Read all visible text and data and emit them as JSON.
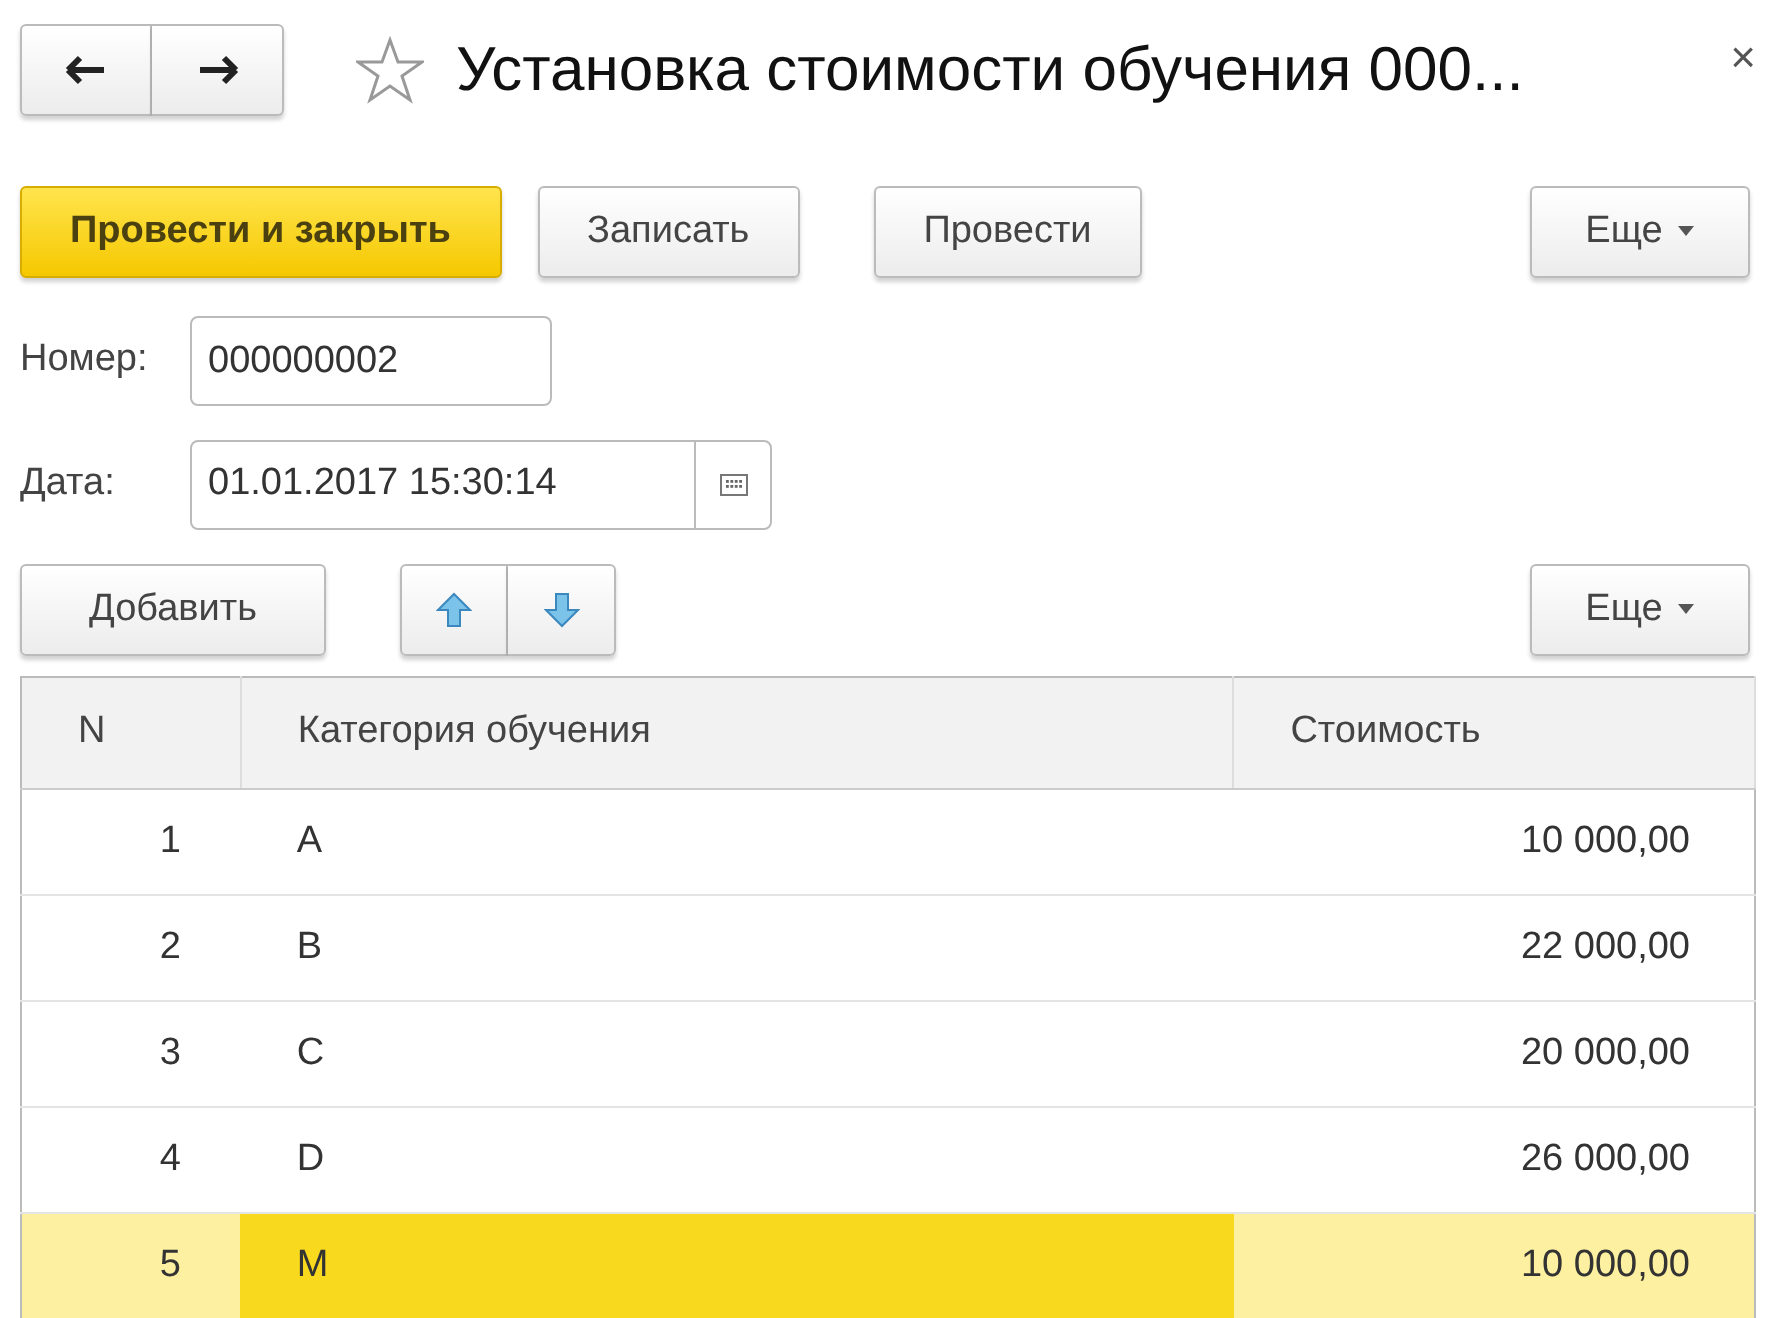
{
  "window": {
    "title": "Установка стоимости обучения 000...",
    "favorite": false,
    "close": "×"
  },
  "toolbar": {
    "buttons": [
      {
        "label": "Провести и закрыть",
        "kind": "primary"
      },
      {
        "label": "Записать",
        "kind": "default"
      },
      {
        "label": "Провести",
        "kind": "default"
      }
    ],
    "more": "Еще"
  },
  "fields": [
    {
      "label": "Номер:",
      "value": "000000002",
      "kind": "text"
    },
    {
      "label": "Дата:",
      "value": "01.01.2017 15:30:14",
      "kind": "date"
    }
  ],
  "table_toolbar": {
    "add": "Добавить",
    "more": "Еще"
  },
  "table": {
    "columns": [
      "N",
      "Категория обучения",
      "Стоимость"
    ],
    "rows": [
      {
        "selected": false,
        "cells": [
          {
            "text": "1",
            "focused": false
          },
          {
            "text": "A",
            "focused": false
          },
          {
            "text": "10 000,00",
            "focused": false
          }
        ]
      },
      {
        "selected": false,
        "cells": [
          {
            "text": "2",
            "focused": false
          },
          {
            "text": "B",
            "focused": false
          },
          {
            "text": "22 000,00",
            "focused": false
          }
        ]
      },
      {
        "selected": false,
        "cells": [
          {
            "text": "3",
            "focused": false
          },
          {
            "text": "C",
            "focused": false
          },
          {
            "text": "20 000,00",
            "focused": false
          }
        ]
      },
      {
        "selected": false,
        "cells": [
          {
            "text": "4",
            "focused": false
          },
          {
            "text": "D",
            "focused": false
          },
          {
            "text": "26 000,00",
            "focused": false
          }
        ]
      },
      {
        "selected": true,
        "cells": [
          {
            "text": "5",
            "focused": false
          },
          {
            "text": "M",
            "focused": true
          },
          {
            "text": "10 000,00",
            "focused": false
          }
        ]
      }
    ]
  }
}
